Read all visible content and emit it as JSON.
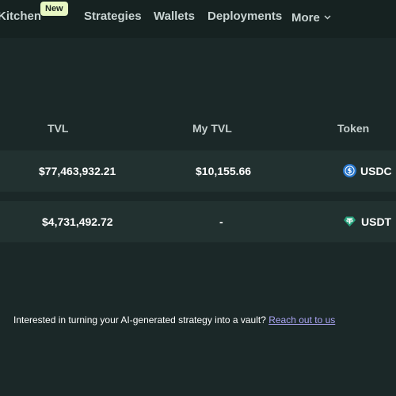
{
  "nav": {
    "kitchen": "Kitchen",
    "new_badge": "New",
    "strategies": "Strategies",
    "wallets": "Wallets",
    "deployments": "Deployments",
    "more": "More"
  },
  "table": {
    "headers": {
      "tvl": "TVL",
      "my_tvl": "My TVL",
      "token": "Token"
    },
    "rows": [
      {
        "tvl": "$77,463,932.21",
        "my_tvl": "$10,155.66",
        "token": "USDC",
        "token_icon": "usdc-icon"
      },
      {
        "tvl": "$4,731,492.72",
        "my_tvl": "-",
        "token": "USDT",
        "token_icon": "usdt-icon"
      }
    ]
  },
  "footer": {
    "text": "Interested in turning your AI-generated strategy into a vault? ",
    "link": "Reach out to us"
  },
  "colors": {
    "background": "#1b2828",
    "row_background": "#223130",
    "badge_background": "#e8f7c4",
    "link": "#a9a3f2",
    "usdc": "#2775ca",
    "usdt": "#26a17b"
  }
}
